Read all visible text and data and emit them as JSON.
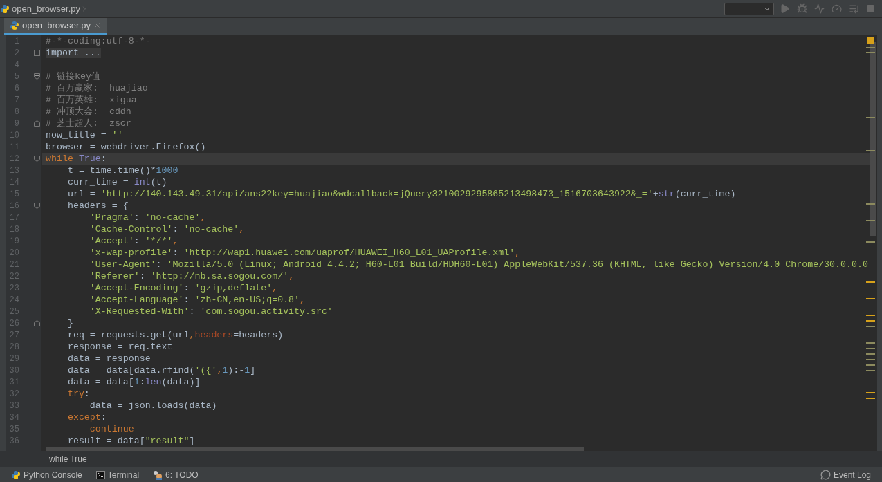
{
  "navbar": {
    "file": "open_browser.py"
  },
  "tabs": [
    {
      "label": "open_browser.py",
      "selected": true
    }
  ],
  "editor": {
    "lines": [
      {
        "number": "1",
        "current": false,
        "tokens": [
          {
            "text": "#-*-coding:utf-8-*-",
            "kind": "comment"
          }
        ]
      },
      {
        "number": "2",
        "current": false,
        "fold": {
          "kind": "expand"
        },
        "tokens": [
          {
            "text": "import ...",
            "kind": "folded"
          }
        ]
      },
      {
        "number": "4",
        "current": false
      },
      {
        "number": "5",
        "current": false,
        "fold": {
          "kind": "start"
        },
        "tokens": [
          {
            "text": "# 链接key值",
            "kind": "comment"
          }
        ]
      },
      {
        "number": "6",
        "current": false,
        "tokens": [
          {
            "text": "# 百万赢家:  huajiao",
            "kind": "comment"
          }
        ]
      },
      {
        "number": "7",
        "current": false,
        "tokens": [
          {
            "text": "# 百万英雄:  xigua",
            "kind": "comment"
          }
        ]
      },
      {
        "number": "8",
        "current": false,
        "tokens": [
          {
            "text": "# 冲顶大会:  cddh",
            "kind": "comment"
          }
        ]
      },
      {
        "number": "9",
        "current": false,
        "fold": {
          "kind": "end"
        },
        "tokens": [
          {
            "text": "# 芝士超人:  zscr",
            "kind": "comment"
          }
        ]
      },
      {
        "number": "10",
        "current": false,
        "tokens": [
          {
            "text": "now_title = ",
            "kind": "plain"
          },
          {
            "text": "''",
            "kind": "string"
          }
        ]
      },
      {
        "number": "11",
        "current": false,
        "tokens": [
          {
            "text": "browser = webdriver.Firefox()",
            "kind": "plain"
          }
        ]
      },
      {
        "number": "12",
        "current": true,
        "fold": {
          "kind": "start"
        },
        "tokens": [
          {
            "text": "while",
            "kind": "keyword"
          },
          {
            "text": " True",
            "kind": "builtin"
          },
          {
            "text": ":",
            "kind": "plain"
          }
        ]
      },
      {
        "number": "13",
        "current": false,
        "tokens": [
          {
            "text": "    t = time.time()*",
            "kind": "plain"
          },
          {
            "text": "1000",
            "kind": "number"
          }
        ]
      },
      {
        "number": "14",
        "current": false,
        "tokens": [
          {
            "text": "    curr_time = ",
            "kind": "plain"
          },
          {
            "text": "int",
            "kind": "builtin"
          },
          {
            "text": "(t)",
            "kind": "plain"
          }
        ]
      },
      {
        "number": "15",
        "current": false,
        "tokens": [
          {
            "text": "    url = ",
            "kind": "plain"
          },
          {
            "text": "'http://140.143.49.31/api/ans2?key=huajiao&wdcallback=jQuery3210029295865213498473_1516703643922&_='",
            "kind": "string"
          },
          {
            "text": "+",
            "kind": "plain"
          },
          {
            "text": "str",
            "kind": "builtin"
          },
          {
            "text": "(curr_time)",
            "kind": "plain"
          }
        ]
      },
      {
        "number": "16",
        "current": false,
        "fold": {
          "kind": "start"
        },
        "tokens": [
          {
            "text": "    headers = {",
            "kind": "plain"
          }
        ]
      },
      {
        "number": "17",
        "current": false,
        "tokens": [
          {
            "text": "        'Pragma'",
            "kind": "string"
          },
          {
            "text": ": ",
            "kind": "plain"
          },
          {
            "text": "'no-cache'",
            "kind": "string"
          },
          {
            "text": ",",
            "kind": "keyword"
          }
        ]
      },
      {
        "number": "18",
        "current": false,
        "tokens": [
          {
            "text": "        'Cache-Control'",
            "kind": "string"
          },
          {
            "text": ": ",
            "kind": "plain"
          },
          {
            "text": "'no-cache'",
            "kind": "string"
          },
          {
            "text": ",",
            "kind": "keyword"
          }
        ]
      },
      {
        "number": "19",
        "current": false,
        "tokens": [
          {
            "text": "        'Accept'",
            "kind": "string"
          },
          {
            "text": ": ",
            "kind": "plain"
          },
          {
            "text": "'*/*'",
            "kind": "string"
          },
          {
            "text": ",",
            "kind": "keyword"
          }
        ]
      },
      {
        "number": "20",
        "current": false,
        "tokens": [
          {
            "text": "        'x-wap-profile'",
            "kind": "string"
          },
          {
            "text": ": ",
            "kind": "plain"
          },
          {
            "text": "'http://wap1.huawei.com/uaprof/HUAWEI_H60_L01_UAProfile.xml'",
            "kind": "string"
          },
          {
            "text": ",",
            "kind": "keyword"
          }
        ]
      },
      {
        "number": "21",
        "current": false,
        "tokens": [
          {
            "text": "        'User-Agent'",
            "kind": "string"
          },
          {
            "text": ": ",
            "kind": "plain"
          },
          {
            "text": "'Mozilla/5.0 (Linux; Android 4.4.2; H60-L01 Build/HDH60-L01) AppleWebKit/537.36 (KHTML, like Gecko) Version/4.0 Chrome/30.0.0.0",
            "kind": "string"
          }
        ]
      },
      {
        "number": "22",
        "current": false,
        "tokens": [
          {
            "text": "        'Referer'",
            "kind": "string"
          },
          {
            "text": ": ",
            "kind": "plain"
          },
          {
            "text": "'http://nb.sa.sogou.com/'",
            "kind": "string"
          },
          {
            "text": ",",
            "kind": "keyword"
          }
        ]
      },
      {
        "number": "23",
        "current": false,
        "tokens": [
          {
            "text": "        'Accept-Encoding'",
            "kind": "string"
          },
          {
            "text": ": ",
            "kind": "plain"
          },
          {
            "text": "'gzip,deflate'",
            "kind": "string"
          },
          {
            "text": ",",
            "kind": "keyword"
          }
        ]
      },
      {
        "number": "24",
        "current": false,
        "tokens": [
          {
            "text": "        'Accept-Language'",
            "kind": "string"
          },
          {
            "text": ": ",
            "kind": "plain"
          },
          {
            "text": "'zh-CN,en-US;q=0.8'",
            "kind": "string"
          },
          {
            "text": ",",
            "kind": "keyword"
          }
        ]
      },
      {
        "number": "25",
        "current": false,
        "tokens": [
          {
            "text": "        'X-Requested-With'",
            "kind": "string"
          },
          {
            "text": ": ",
            "kind": "plain"
          },
          {
            "text": "'com.sogou.activity.src'",
            "kind": "string"
          }
        ]
      },
      {
        "number": "26",
        "current": false,
        "fold": {
          "kind": "end"
        },
        "tokens": [
          {
            "text": "    }",
            "kind": "plain"
          }
        ]
      },
      {
        "number": "27",
        "current": false,
        "tokens": [
          {
            "text": "    req = requests.get(url",
            "kind": "plain"
          },
          {
            "text": ",",
            "kind": "keyword"
          },
          {
            "text": "headers",
            "kind": "param"
          },
          {
            "text": "=headers)",
            "kind": "plain"
          }
        ]
      },
      {
        "number": "28",
        "current": false,
        "tokens": [
          {
            "text": "    response = req.text",
            "kind": "plain"
          }
        ]
      },
      {
        "number": "29",
        "current": false,
        "tokens": [
          {
            "text": "    data = response",
            "kind": "plain"
          }
        ]
      },
      {
        "number": "30",
        "current": false,
        "tokens": [
          {
            "text": "    data = data[data.rfind(",
            "kind": "plain"
          },
          {
            "text": "'({'",
            "kind": "string"
          },
          {
            "text": ",",
            "kind": "keyword"
          },
          {
            "text": "1",
            "kind": "number"
          },
          {
            "text": "):-",
            "kind": "plain"
          },
          {
            "text": "1",
            "kind": "number"
          },
          {
            "text": "]",
            "kind": "plain"
          }
        ]
      },
      {
        "number": "31",
        "current": false,
        "tokens": [
          {
            "text": "    data = data[",
            "kind": "plain"
          },
          {
            "text": "1",
            "kind": "number"
          },
          {
            "text": ":",
            "kind": "plain"
          },
          {
            "text": "len",
            "kind": "builtin"
          },
          {
            "text": "(data)]",
            "kind": "plain"
          }
        ]
      },
      {
        "number": "32",
        "current": false,
        "tokens": [
          {
            "text": "    try",
            "kind": "keyword"
          },
          {
            "text": ":",
            "kind": "plain"
          }
        ]
      },
      {
        "number": "33",
        "current": false,
        "tokens": [
          {
            "text": "        data = json.loads(data)",
            "kind": "plain"
          }
        ]
      },
      {
        "number": "34",
        "current": false,
        "tokens": [
          {
            "text": "    except",
            "kind": "keyword"
          },
          {
            "text": ":",
            "kind": "plain"
          }
        ]
      },
      {
        "number": "35",
        "current": false,
        "tokens": [
          {
            "text": "        continue",
            "kind": "keyword"
          }
        ]
      },
      {
        "number": "36",
        "current": false,
        "tokens": [
          {
            "text": "    result = data[",
            "kind": "plain"
          },
          {
            "text": "\"result\"",
            "kind": "string"
          },
          {
            "text": "]",
            "kind": "plain"
          }
        ]
      }
    ]
  },
  "breadcrumb": "while True",
  "tool_windows": [
    {
      "kind": "python",
      "label": "Python Console"
    },
    {
      "kind": "terminal",
      "label": "Terminal"
    },
    {
      "kind": "todo",
      "mnemonic": "6",
      "label": ": TODO"
    }
  ],
  "event_log": "Event Log"
}
